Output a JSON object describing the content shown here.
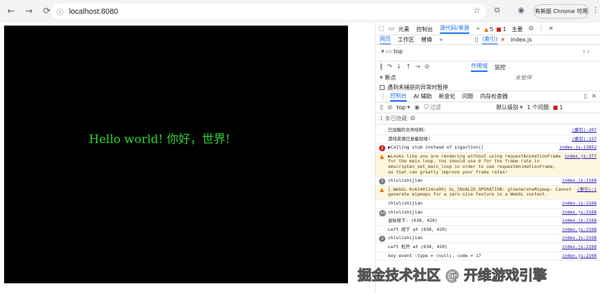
{
  "browser": {
    "back": "←",
    "forward": "→",
    "reload": "⟳",
    "url": "localhost:8080",
    "update_button": "有新版 Chrome 可用"
  },
  "viewport": {
    "text": "Hello world! 你好，世界!"
  },
  "devtools": {
    "top_tabs": [
      "元素",
      "控制台",
      "源代码/来源"
    ],
    "warn_count": "5",
    "error_count": "1",
    "theme": "主要",
    "sources_tabs": [
      "网页",
      "工作区",
      "替换"
    ],
    "file_tabs": [
      "(索引)",
      "index.js"
    ],
    "tree_top": "top",
    "scope_tabs": [
      "作用域",
      "监控"
    ],
    "not_paused": "未暂停",
    "breakpoints": "断点",
    "pause_on_uncaught": "遇到未捕获的异常时暂停",
    "drawer_tabs": [
      "控制台",
      "AI 辅助",
      "新变化",
      "问题",
      "内存检查器"
    ],
    "context": "top",
    "filter_placeholder": "过滤",
    "levels": "默认级别",
    "issues": "1 个问题:",
    "issue_count": "1",
    "hidden": "1 条已隐藏"
  },
  "console": [
    {
      "type": "log",
      "text": "已加载的文件结构:",
      "src": "(索引):207"
    },
    {
      "type": "log",
      "text": "游戏资源已准备就绪!",
      "src": "(索引):237"
    },
    {
      "type": "log",
      "badge": "2",
      "badge_color": "red",
      "text": "▶Calling stub instead of sigaction()",
      "src": "index.js:13852"
    },
    {
      "type": "warn",
      "text": "▶Looks like you are rendering without using requestAnimationFrame for the main loop. You should use 0 for the frame rate in emscripten_set_main_loop in order to use requestAnimationFrame, as that can greatly improve your frame rates!",
      "src": "index.js:377"
    },
    {
      "type": "log",
      "badge": "3",
      "text": "chlulishijian",
      "src": "index.js:2168"
    },
    {
      "type": "warn",
      "text": "[.WebGL-0x6140114ce00] GL_INVALID_OPERATION: glGenerateMipmap: Cannot generate mipmaps for a zero-size texture in a WebGL context.",
      "src": "(索引):1"
    },
    {
      "type": "log",
      "text": "chlulishijian",
      "src": "index.js:2168"
    },
    {
      "type": "log",
      "badge": "24",
      "text": "chlulishijian",
      "src": "index.js:2168"
    },
    {
      "type": "log",
      "text": "鼠标按下: (638, 420)",
      "src": "index.js:2168"
    },
    {
      "type": "log",
      "text": "Left 按下 at (638, 420)",
      "src": "index.js:2168"
    },
    {
      "type": "log",
      "badge": "3",
      "text": "chlulishijian",
      "src": "index.js:2168"
    },
    {
      "type": "log",
      "text": "Left 松开 at (638, 420)",
      "src": "index.js:2168"
    },
    {
      "type": "log",
      "text": "key event :type = (null), code = 17",
      "src": "index.js:2168"
    }
  ],
  "watermark": "掘金技术社区 @ 开维游戏引擎"
}
